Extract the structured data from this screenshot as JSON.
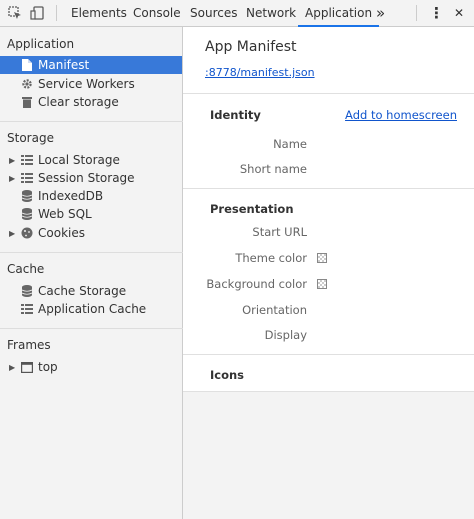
{
  "toolbar": {
    "tabs": [
      {
        "label": "Elements"
      },
      {
        "label": "Console"
      },
      {
        "label": "Sources"
      },
      {
        "label": "Network"
      },
      {
        "label": "Application"
      }
    ],
    "more_label": "»",
    "menu_label": "⋮",
    "close_label": "✕"
  },
  "sidebar": {
    "application": {
      "title": "Application",
      "items": [
        {
          "label": "Manifest",
          "icon": "file-icon"
        },
        {
          "label": "Service Workers",
          "icon": "gear-icon"
        },
        {
          "label": "Clear storage",
          "icon": "trash-icon"
        }
      ]
    },
    "storage": {
      "title": "Storage",
      "items": [
        {
          "label": "Local Storage",
          "icon": "grid-icon"
        },
        {
          "label": "Session Storage",
          "icon": "grid-icon"
        },
        {
          "label": "IndexedDB",
          "icon": "database-icon"
        },
        {
          "label": "Web SQL",
          "icon": "database-icon"
        },
        {
          "label": "Cookies",
          "icon": "cookie-icon"
        }
      ]
    },
    "cache": {
      "title": "Cache",
      "items": [
        {
          "label": "Cache Storage",
          "icon": "database-icon"
        },
        {
          "label": "Application Cache",
          "icon": "grid-icon"
        }
      ]
    },
    "frames": {
      "title": "Frames",
      "items": [
        {
          "label": "top",
          "icon": "frame-icon"
        }
      ]
    }
  },
  "main": {
    "title": "App Manifest",
    "manifest_url": ":8778/manifest.json",
    "identity": {
      "title": "Identity",
      "add_to_homescreen": "Add to homescreen",
      "fields": [
        "Name",
        "Short name"
      ]
    },
    "presentation": {
      "title": "Presentation",
      "fields": [
        "Start URL",
        "Theme color",
        "Background color",
        "Orientation",
        "Display"
      ]
    },
    "icons": {
      "title": "Icons"
    }
  },
  "colors": {
    "selected_bg": "#3879d9",
    "link": "#1155cc",
    "active_tab_underline": "#1a73e8"
  }
}
